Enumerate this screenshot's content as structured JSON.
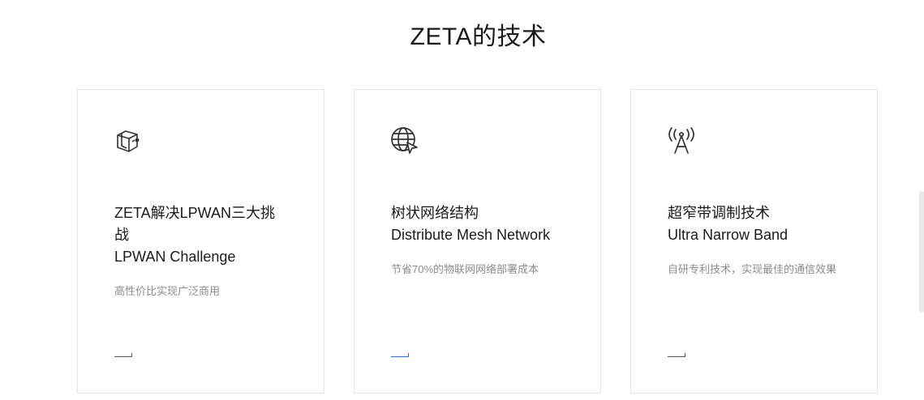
{
  "section": {
    "title": "ZETA的技术"
  },
  "cards": [
    {
      "icon": "cube-shield-icon",
      "title_cn": "ZETA解决LPWAN三大挑战",
      "title_en": "LPWAN Challenge",
      "desc": "高性价比实现广泛商用"
    },
    {
      "icon": "globe-cursor-icon",
      "title_cn": "树状网络结构",
      "title_en": "Distribute Mesh Network",
      "desc": "节省70%的物联网网络部署成本"
    },
    {
      "icon": "antenna-tower-icon",
      "title_cn": "超窄带调制技术",
      "title_en": "Ultra Narrow Band",
      "desc": "自研专利技术，实现最佳的通信效果"
    }
  ],
  "colors": {
    "accent": "#3b6cd9",
    "border": "#e6e6e6",
    "desc": "#8c8c8c"
  }
}
